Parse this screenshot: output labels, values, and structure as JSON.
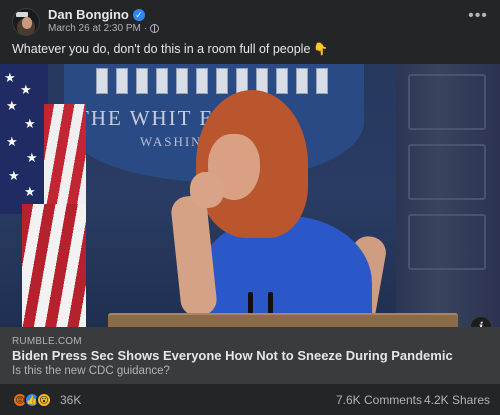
{
  "post": {
    "author": "Dan Bongino",
    "timestamp": "March 26 at 2:30 PM",
    "separator": "·",
    "caption": "Whatever you do, don't do this in a room full of people",
    "caption_emoji": "👇",
    "more_icon": "•••"
  },
  "media": {
    "wall_title": "THE WHIT    E",
    "wall_subtitle": "WASHIN"
  },
  "link": {
    "domain": "RUMBLE.COM",
    "title": "Biden Press Sec Shows Everyone How Not to Sneeze During Pandemic",
    "description": "Is this the new CDC guidance?"
  },
  "engagement": {
    "reaction_count": "36K",
    "comments": "7.6K Comments",
    "shares": "4.2K Shares"
  },
  "icons": {
    "verified": "verified-badge-icon",
    "privacy": "globe-icon",
    "more": "more-options-icon",
    "info": "info-icon"
  },
  "colors": {
    "background": "#242526",
    "link_preview_bg": "#3a3b3c",
    "text_primary": "#e4e6eb",
    "text_secondary": "#b0b3b8",
    "verified_blue": "#2d88ff"
  }
}
